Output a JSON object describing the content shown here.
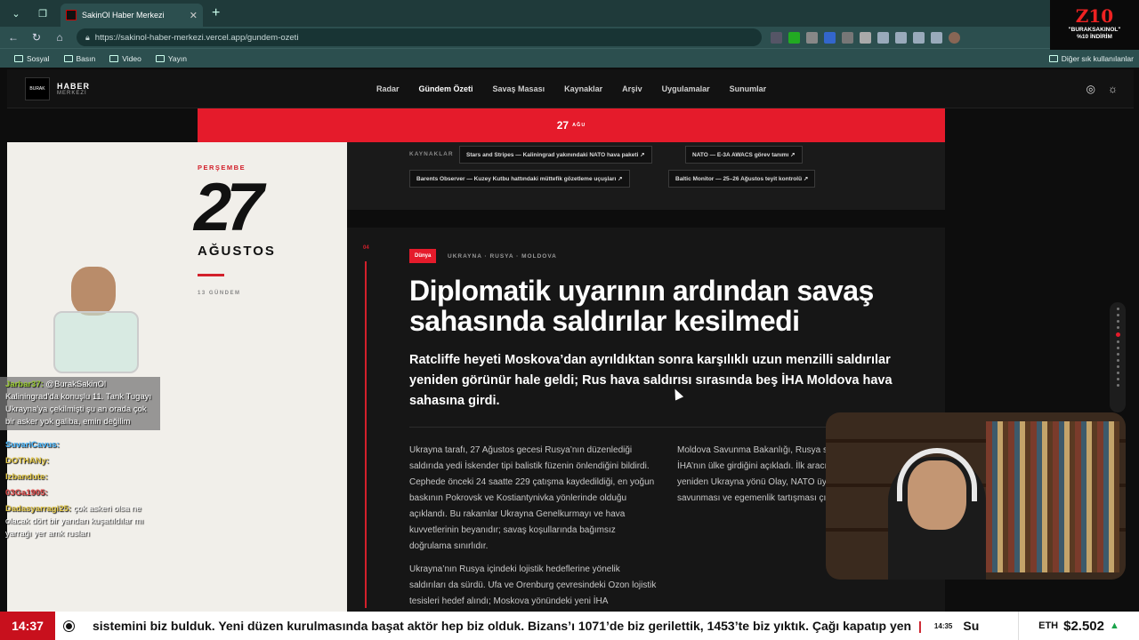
{
  "browser": {
    "tab_title": "SakinOl Haber Merkezi",
    "url": "https://sakinol-haber-merkezi.vercel.app/gundem-ozeti",
    "bookmarks": [
      "Sosyal",
      "Basın",
      "Video",
      "Yayın"
    ],
    "bookmarks_other": "Diğer sık kullanılanlar"
  },
  "promo": {
    "logo": "Z10",
    "line1": "\"BURAKSAKINOL\"",
    "line2": "%10 İNDİRİM"
  },
  "site": {
    "brand_title": "HABER",
    "brand_sub": "MERKEZİ",
    "menu": [
      "Radar",
      "Gündem Özeti",
      "Savaş Masası",
      "Kaynaklar",
      "Arşiv",
      "Uygulamalar",
      "Sunumlar"
    ],
    "active_menu": "Gündem Özeti"
  },
  "date_bar": {
    "day": "27",
    "month": "AĞU"
  },
  "date_panel": {
    "weekday": "PERŞEMBE",
    "day": "27",
    "month": "AĞUSTOS",
    "count": "13 GÜNDEM"
  },
  "sources": {
    "label": "KAYNAKLAR",
    "items": [
      "Stars and Stripes — Kaliningrad yakınındaki NATO hava paketi ↗",
      "NATO — E-3A AWACS görev tanımı ↗",
      "Barents Observer — Kuzey Kutbu hattındaki müttefik gözetleme uçuşları ↗",
      "Baltic Monitor — 25–26 Ağustos teyit kontrolü ↗"
    ]
  },
  "article": {
    "number": "04",
    "category": "Dünya",
    "tags": "UKRAYNA · RUSYA · MOLDOVA",
    "title": "Diplomatik uyarının ardından savaş sahasında saldırılar kesilmedi",
    "subtitle": "Ratcliffe heyeti Moskova’dan ayrıldıktan sonra karşılıklı uzun menzilli saldırılar yeniden görünür hale geldi; Rus hava saldırısı sırasında beş İHA Moldova hava sahasına girdi.",
    "col1_p1": "Ukrayna tarafı, 27 Ağustos gecesi Rusya’nın düzenlediği saldırıda yedi İskender tipi balistik füzenin önlendiğini bildirdi. Cephede önceki 24 saatte 229 çatışma kaydedildiği, en yoğun baskının Pokrovsk ve Kostiantynivka yönlerinde olduğu açıklandı. Bu rakamlar Ukrayna Genelkurmayı ve hava kuvvetlerinin beyanıdır; savaş koşullarında bağımsız doğrulama sınırlıdır.",
    "col1_p2": "Ukrayna’nın Rusya içindeki lojistik hedeflerine yönelik saldırıları da sürdü. Ufa ve Orenburg çevresindeki Ozon lojistik tesisleri hedef alındı; Moskova yönündeki yeni İHA",
    "col2_p1": "Moldova Savunma Bakanlığı, Rusya saldırısı sırasında beş İHA’nın ülke girdiğini açıkladı. İlk aracın 03.56’da dakika sonra yeniden Ukrayna yönü Olay, NATO üyesi olmayan Moldova savunması ve egemenlik tartışması çıkardı."
  },
  "chat": [
    {
      "user": "Jarbar37:",
      "text": " @BurakSakinOl Kaliningrad'da konuşlu 11. Tank Tugayı Ukrayna'ya çekilmişti şu an orada çok bir asker yok galiba, emin değilim"
    },
    {
      "user": "SuvariCavus:",
      "text": ""
    },
    {
      "user": "DOTHANy:",
      "text": ""
    },
    {
      "user": "Izbandute:",
      "text": ""
    },
    {
      "user": "03Ga1905:",
      "text": ""
    },
    {
      "user": "Dadasyarragi25:",
      "text": " çok askeri olsa ne olacak dört bir yandan kuşatıldılar mı yarrağı yer amk rusları"
    }
  ],
  "ticker": {
    "clock": "14:37",
    "text": "sistemini biz bulduk. Yeni düzen kurulmasında başat aktör hep biz olduk. Bizans’ı 1071’de biz gerilettik, 1453’te biz yıktık. Çağı kapatıp yeni bir",
    "time2": "14:35",
    "next": "Su"
  },
  "crypto": {
    "symbol": "ETH",
    "value": "$2.502",
    "arrow": "▲"
  }
}
